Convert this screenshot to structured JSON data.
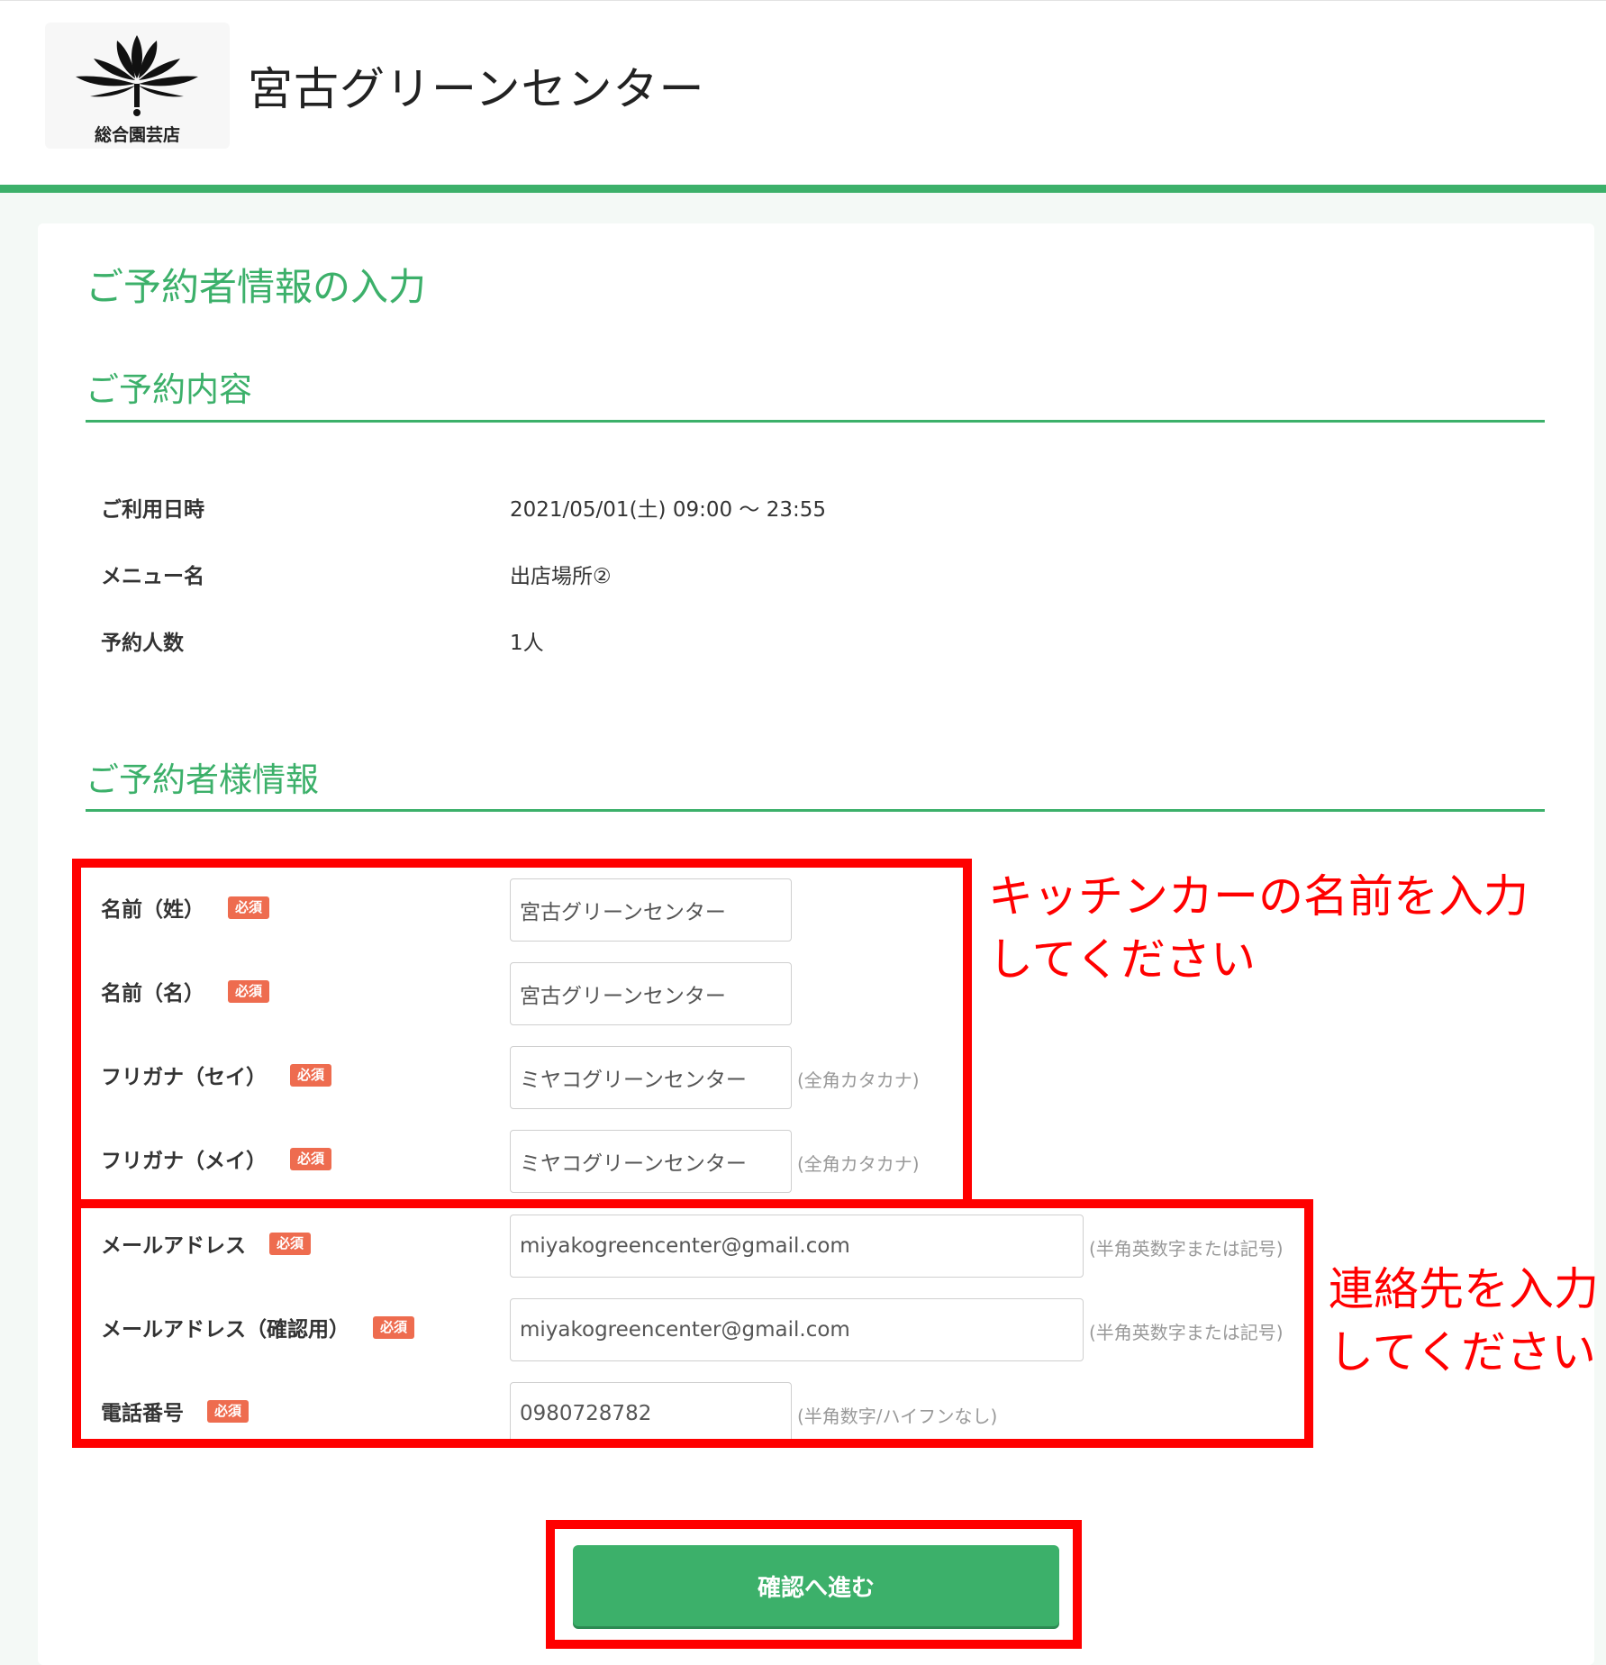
{
  "header": {
    "brand_name": "宮古グリーンセンター",
    "logo_subtitle": "総合園芸店"
  },
  "page_title": "ご予約者情報の入力",
  "reservation_section": {
    "title": "ご予約内容",
    "rows": [
      {
        "label": "ご利用日時",
        "value": "2021/05/01(土) 09:00 ～ 23:55"
      },
      {
        "label": "メニュー名",
        "value": "出店場所②"
      },
      {
        "label": "予約人数",
        "value": "1人"
      }
    ]
  },
  "customer_section": {
    "title": "ご予約者様情報",
    "required_badge": "必須",
    "fields": [
      {
        "label": "名前（姓）",
        "value": "宮古グリーンセンター",
        "note": ""
      },
      {
        "label": "名前（名）",
        "value": "宮古グリーンセンター",
        "note": ""
      },
      {
        "label": "フリガナ（セイ）",
        "value": "ミヤコグリーンセンター",
        "note": "(全角カタカナ)"
      },
      {
        "label": "フリガナ（メイ）",
        "value": "ミヤコグリーンセンター",
        "note": "(全角カタカナ)"
      },
      {
        "label": "メールアドレス",
        "value": "miyakogreencenter@gmail.com",
        "note": "(半角英数字または記号)"
      },
      {
        "label": "メールアドレス（確認用）",
        "value": "miyakogreencenter@gmail.com",
        "note": "(半角英数字または記号)"
      },
      {
        "label": "電話番号",
        "value": "0980728782",
        "note": "(半角数字/ハイフンなし)"
      }
    ]
  },
  "annotations": {
    "name": {
      "line1": "キッチンカーの名前を入力",
      "line2": "してください"
    },
    "contact": {
      "line1": "連絡先を入力",
      "line2": "してください"
    }
  },
  "submit_label": "確認へ進む",
  "colors": {
    "accent_green": "#3cb06a",
    "required_badge": "#ee6c4f",
    "annotation_red": "#ff0000"
  }
}
